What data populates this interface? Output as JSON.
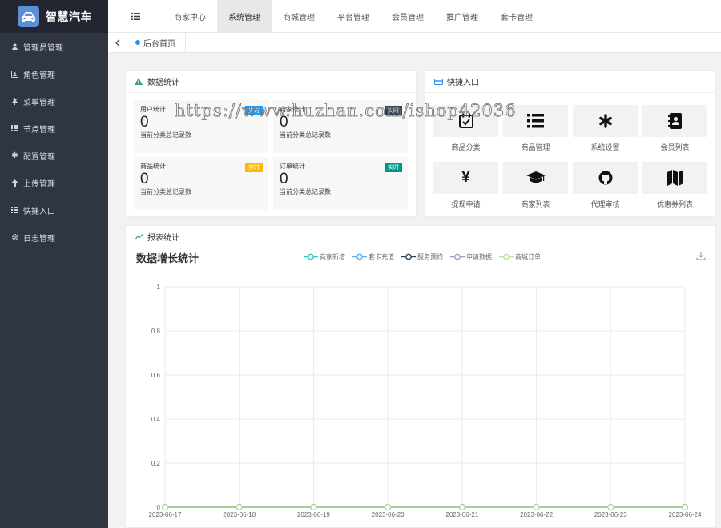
{
  "app": {
    "title": "智慧汽车"
  },
  "sidebar": {
    "items": [
      {
        "label": "管理员管理",
        "icon": "user-icon"
      },
      {
        "label": "角色管理",
        "icon": "id-card-icon"
      },
      {
        "label": "菜单管理",
        "icon": "tree-icon"
      },
      {
        "label": "节点管理",
        "icon": "list-icon"
      },
      {
        "label": "配置管理",
        "icon": "asterisk-icon"
      },
      {
        "label": "上传管理",
        "icon": "upload-arrow-icon"
      },
      {
        "label": "快捷入口",
        "icon": "list-icon"
      },
      {
        "label": "日志管理",
        "icon": "gear-icon"
      }
    ]
  },
  "topnav": {
    "active": "系统管理",
    "tabs": [
      "商家中心",
      "系统管理",
      "商城管理",
      "平台管理",
      "会员管理",
      "推广管理",
      "套卡管理"
    ]
  },
  "breadcrumb": {
    "home": "后台首页"
  },
  "stats_card": {
    "title": "数据统计",
    "items": [
      {
        "label": "用户统计",
        "badge": "实时",
        "badge_color": "#1e9fff",
        "value": "0",
        "desc": "当前分类总记录数"
      },
      {
        "label": "商家统计",
        "badge": "实时",
        "badge_color": "#2f4056",
        "value": "0",
        "desc": "当前分类总记录数"
      },
      {
        "label": "商品统计",
        "badge": "实时",
        "badge_color": "#ffb800",
        "value": "0",
        "desc": "当前分类总记录数"
      },
      {
        "label": "订单统计",
        "badge": "实时",
        "badge_color": "#009688",
        "value": "0",
        "desc": "当前分类总记录数"
      }
    ]
  },
  "quick_card": {
    "title": "快捷入口",
    "items": [
      {
        "label": "商品分类",
        "icon": "calendar-check-icon"
      },
      {
        "label": "商品管理",
        "icon": "list-icon"
      },
      {
        "label": "系统设置",
        "icon": "asterisk-icon"
      },
      {
        "label": "会员列表",
        "icon": "address-book-icon"
      },
      {
        "label": "提现申请",
        "icon": "yen-icon"
      },
      {
        "label": "商家列表",
        "icon": "graduation-cap-icon"
      },
      {
        "label": "代理审核",
        "icon": "github-icon"
      },
      {
        "label": "优惠券列表",
        "icon": "map-icon"
      }
    ]
  },
  "report_card": {
    "title": "报表统计"
  },
  "watermark": "https://www.huzhan.com/ishop42036",
  "chart_data": {
    "type": "line",
    "title": "数据增长统计",
    "categories": [
      "2023-06-17",
      "2023-06-18",
      "2023-06-19",
      "2023-06-20",
      "2023-06-21",
      "2023-06-22",
      "2023-06-23",
      "2023-06-24"
    ],
    "ylim": [
      0,
      1
    ],
    "yticks": [
      "0",
      "0.2",
      "0.4",
      "0.6",
      "0.8",
      "1"
    ],
    "grid": true,
    "legend_position": "top",
    "series": [
      {
        "name": "商家新增",
        "color": "#2ec7c9",
        "values": [
          0,
          0,
          0,
          0,
          0,
          0,
          0,
          0
        ]
      },
      {
        "name": "套卡充值",
        "color": "#5ab1ef",
        "values": [
          0,
          0,
          0,
          0,
          0,
          0,
          0,
          0
        ]
      },
      {
        "name": "服务预约",
        "color": "#2f4554",
        "values": [
          0,
          0,
          0,
          0,
          0,
          0,
          0,
          0
        ]
      },
      {
        "name": "申请数据",
        "color": "#9a9fd0",
        "values": [
          0,
          0,
          0,
          0,
          0,
          0,
          0,
          0
        ]
      },
      {
        "name": "商城订单",
        "color": "#b6e396",
        "values": [
          0,
          0,
          0,
          0,
          0,
          0,
          0,
          0
        ]
      }
    ]
  }
}
